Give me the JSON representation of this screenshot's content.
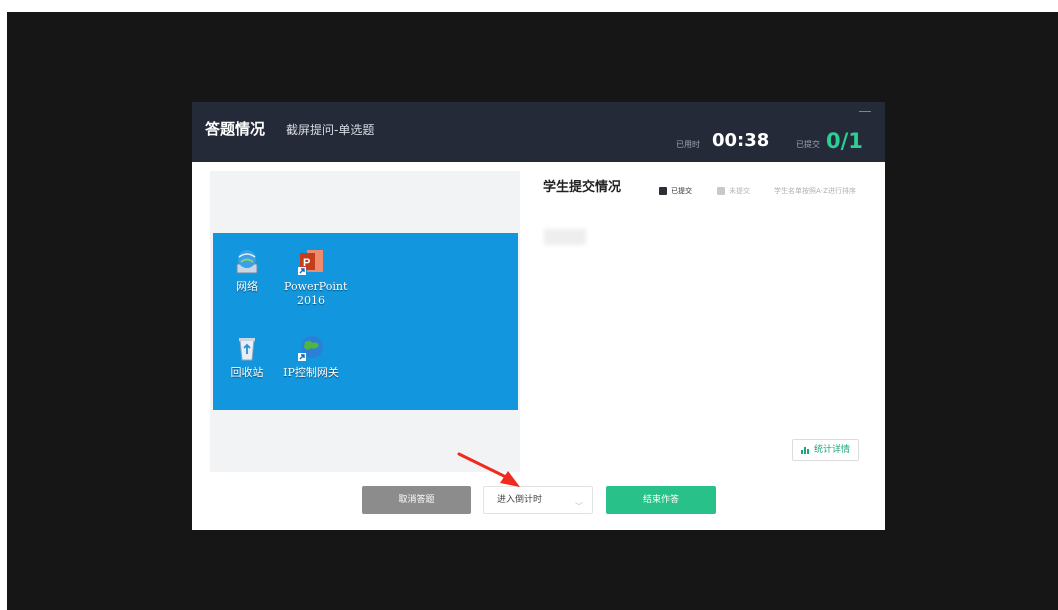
{
  "header": {
    "title": "答题情况",
    "subtitle": "截屏提问-单选题",
    "timer_label": "已用时",
    "timer_value": "00:38",
    "submitted_label": "已提交",
    "submitted_value": "0/1"
  },
  "desktop": {
    "icons": [
      {
        "label": "网络",
        "icon": "network-icon"
      },
      {
        "label": "PowerPoint 2016",
        "icon": "powerpoint-icon"
      },
      {
        "label": "回收站",
        "icon": "recycle-bin-icon"
      },
      {
        "label": "IP控制网关",
        "icon": "ip-gateway-icon"
      }
    ]
  },
  "submission": {
    "title": "学生提交情况",
    "legend_submitted": "已提交",
    "legend_unsubmitted": "未提交",
    "sort_note": "学生名单按照A-Z进行排序",
    "stats_button": "统计详情"
  },
  "footer": {
    "cancel_label": "取消答题",
    "countdown_value": "进入倒计时",
    "end_label": "结束作答"
  },
  "colors": {
    "header_bg": "#252a38",
    "accent_green": "#28c18a",
    "desktop_blue": "#1297de",
    "arrow_red": "#f02a1e"
  }
}
